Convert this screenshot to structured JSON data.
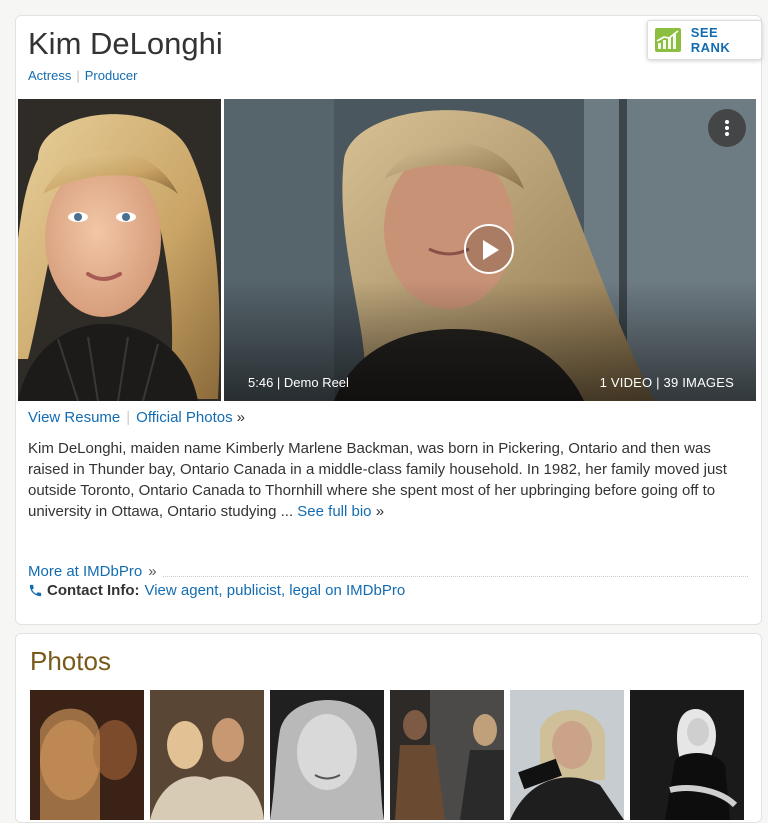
{
  "profile": {
    "name": "Kim DeLonghi",
    "roles": [
      "Actress",
      "Producer"
    ],
    "see_rank_label": "SEE RANK"
  },
  "video": {
    "caption": "5:46 | Demo Reel",
    "counts": "1 VIDEO | 39 IMAGES"
  },
  "links": {
    "resume": "View Resume",
    "photos": "Official Photos",
    "raquo": "»"
  },
  "bio": {
    "text": "Kim DeLonghi, maiden name Kimberly Marlene Backman, was born in Pickering, Ontario and then was raised in Thunder bay, Ontario Canada in a middle-class family household. In 1982, her family moved just outside Toronto, Ontario Canada to Thornhill where she spent most of her upbringing before going off to university in Ottawa, Ontario studying ...",
    "see_full_bio": "See full bio",
    "raquo": "»"
  },
  "imdbpro": {
    "more_label": "More at IMDbPro",
    "raquo": "»",
    "contact_label": "Contact Info:",
    "contact_link": "View agent, publicist, legal on IMDbPro"
  },
  "photos": {
    "title": "Photos"
  },
  "colors": {
    "link": "#136cb2",
    "photos_title": "#7a5a1b",
    "rank_green": "#8cbf3f"
  }
}
